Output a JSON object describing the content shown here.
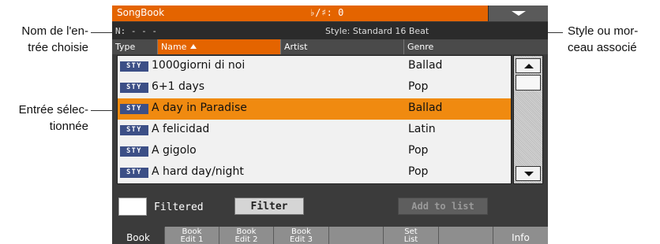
{
  "annotations": {
    "entry_name_line1": "Nom de l'en-",
    "entry_name_line2": "trée choisie",
    "selected_line1": "Entrée sélec-",
    "selected_line2": "tionnée",
    "style_line1": "Style ou mor-",
    "style_line2": "ceau associé"
  },
  "titlebar": {
    "title": "SongBook",
    "transpose": "♭/♯: 0",
    "menu_icon": "dropdown-arrow"
  },
  "info": {
    "entry_number": "N: - - -",
    "style": "Style: Standard 16 Beat"
  },
  "columns": {
    "type": "Type",
    "name": "Name",
    "artist": "Artist",
    "genre": "Genre",
    "sorted_column": "Name"
  },
  "rows": [
    {
      "tag": "STY",
      "name": "1000giorni di noi",
      "genre": "Ballad"
    },
    {
      "tag": "STY",
      "name": "6+1 days",
      "genre": "Pop"
    },
    {
      "tag": "STY",
      "name": "A day in Paradise",
      "genre": "Ballad"
    },
    {
      "tag": "STY",
      "name": "A felicidad",
      "genre": "Latin"
    },
    {
      "tag": "STY",
      "name": "A gigolo",
      "genre": "Pop"
    },
    {
      "tag": "STY",
      "name": "A hard day/night",
      "genre": "Pop"
    }
  ],
  "selected_row": "A day in Paradise",
  "controls": {
    "filtered_label": "Filtered",
    "filter_button": "Filter",
    "add_to_list_button": "Add to list"
  },
  "tabs": {
    "book": "Book",
    "book_edit1_l1": "Book",
    "book_edit1_l2": "Edit 1",
    "book_edit2_l1": "Book",
    "book_edit2_l2": "Edit 2",
    "book_edit3_l1": "Book",
    "book_edit3_l2": "Edit 3",
    "set_list_l1": "Set",
    "set_list_l2": "List",
    "info": "Info"
  },
  "colors": {
    "accent": "#e46400",
    "selection": "#f08a10",
    "style_tag": "#3c4f86"
  }
}
